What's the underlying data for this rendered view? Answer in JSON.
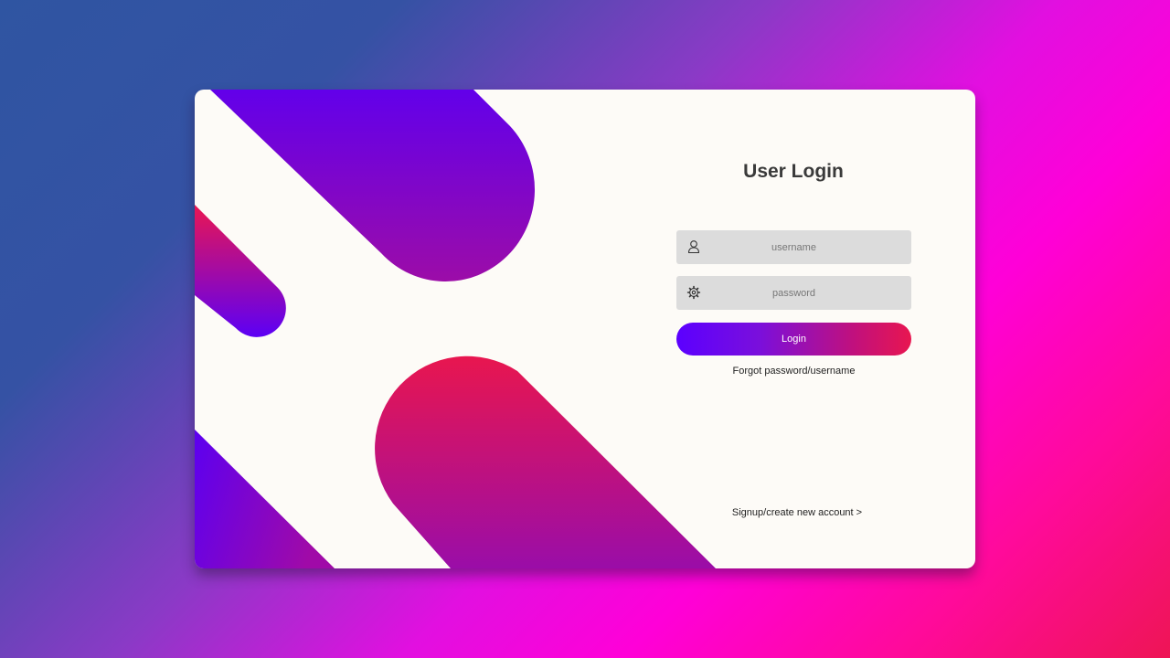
{
  "login": {
    "title": "User Login",
    "username_placeholder": "username",
    "username_value": "",
    "password_placeholder": "password",
    "password_value": "",
    "login_label": "Login",
    "forgot_label": "Forgot password/username",
    "signup_label": "Signup/create new account >"
  },
  "icons": {
    "username": "user-icon",
    "password": "gear-icon"
  },
  "colors": {
    "card_background": "#fdfbf7",
    "field_background": "#dcdcdc",
    "title_text": "#3a3a3a",
    "button_gradient_start": "#5b00ff",
    "button_gradient_end": "#e81650",
    "violet": "#6200ea",
    "crimson": "#e8164f"
  }
}
